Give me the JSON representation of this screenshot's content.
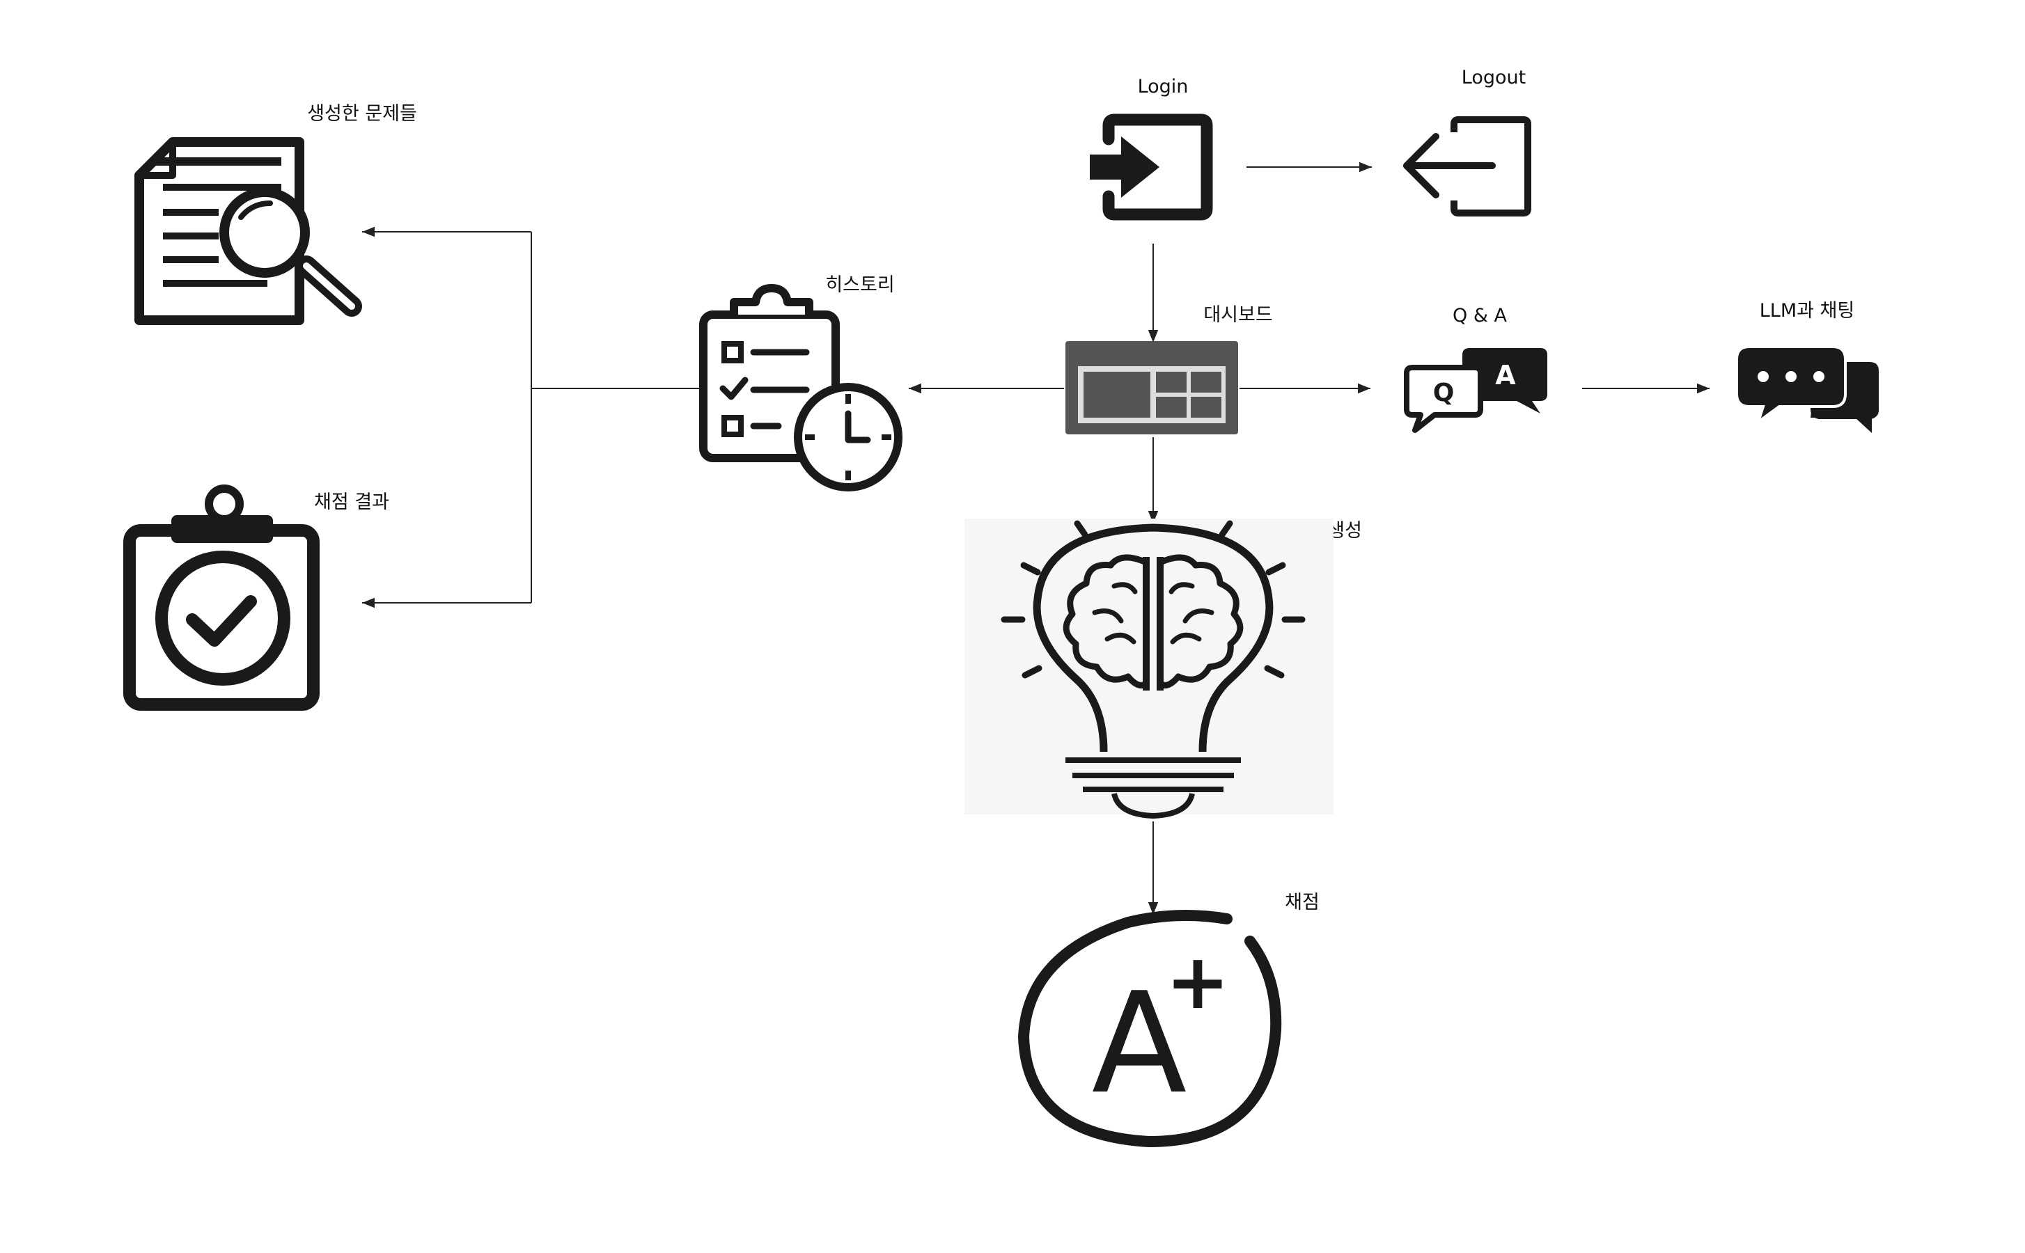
{
  "nodes": {
    "login": {
      "label": "Login",
      "icon": "login-icon"
    },
    "logout": {
      "label": "Logout",
      "icon": "logout-icon"
    },
    "dashboard": {
      "label": "대시보드",
      "icon": "dashboard-icon"
    },
    "qa": {
      "label": "Q & A",
      "icon": "qa-speech-bubbles-icon",
      "bubble_q": "Q",
      "bubble_a": "A"
    },
    "llm_chat": {
      "label": "LLM과 채팅",
      "icon": "chat-bubbles-icon"
    },
    "history": {
      "label": "히스토리",
      "icon": "clipboard-checklist-clock-icon"
    },
    "generated_problems": {
      "label": "생성한 문제들",
      "icon": "document-search-icon"
    },
    "grading_results": {
      "label": "채점 결과",
      "icon": "clipboard-check-icon"
    },
    "problem_generation": {
      "label": "문제 생성",
      "icon": "lightbulb-brain-icon"
    },
    "grading": {
      "label": "채점",
      "icon": "grade-a-plus-icon",
      "grade_text": "A",
      "grade_sign": "+"
    }
  },
  "edges": [
    {
      "from": "login",
      "to": "logout"
    },
    {
      "from": "login",
      "to": "dashboard"
    },
    {
      "from": "dashboard",
      "to": "qa"
    },
    {
      "from": "qa",
      "to": "llm_chat"
    },
    {
      "from": "dashboard",
      "to": "history"
    },
    {
      "from": "history",
      "to": "generated_problems"
    },
    {
      "from": "history",
      "to": "grading_results"
    },
    {
      "from": "dashboard",
      "to": "problem_generation"
    },
    {
      "from": "problem_generation",
      "to": "grading"
    }
  ],
  "colors": {
    "icon": "#1a1a1a",
    "dashboard_frame": "#555555",
    "line": "#222222",
    "background": "#ffffff"
  }
}
